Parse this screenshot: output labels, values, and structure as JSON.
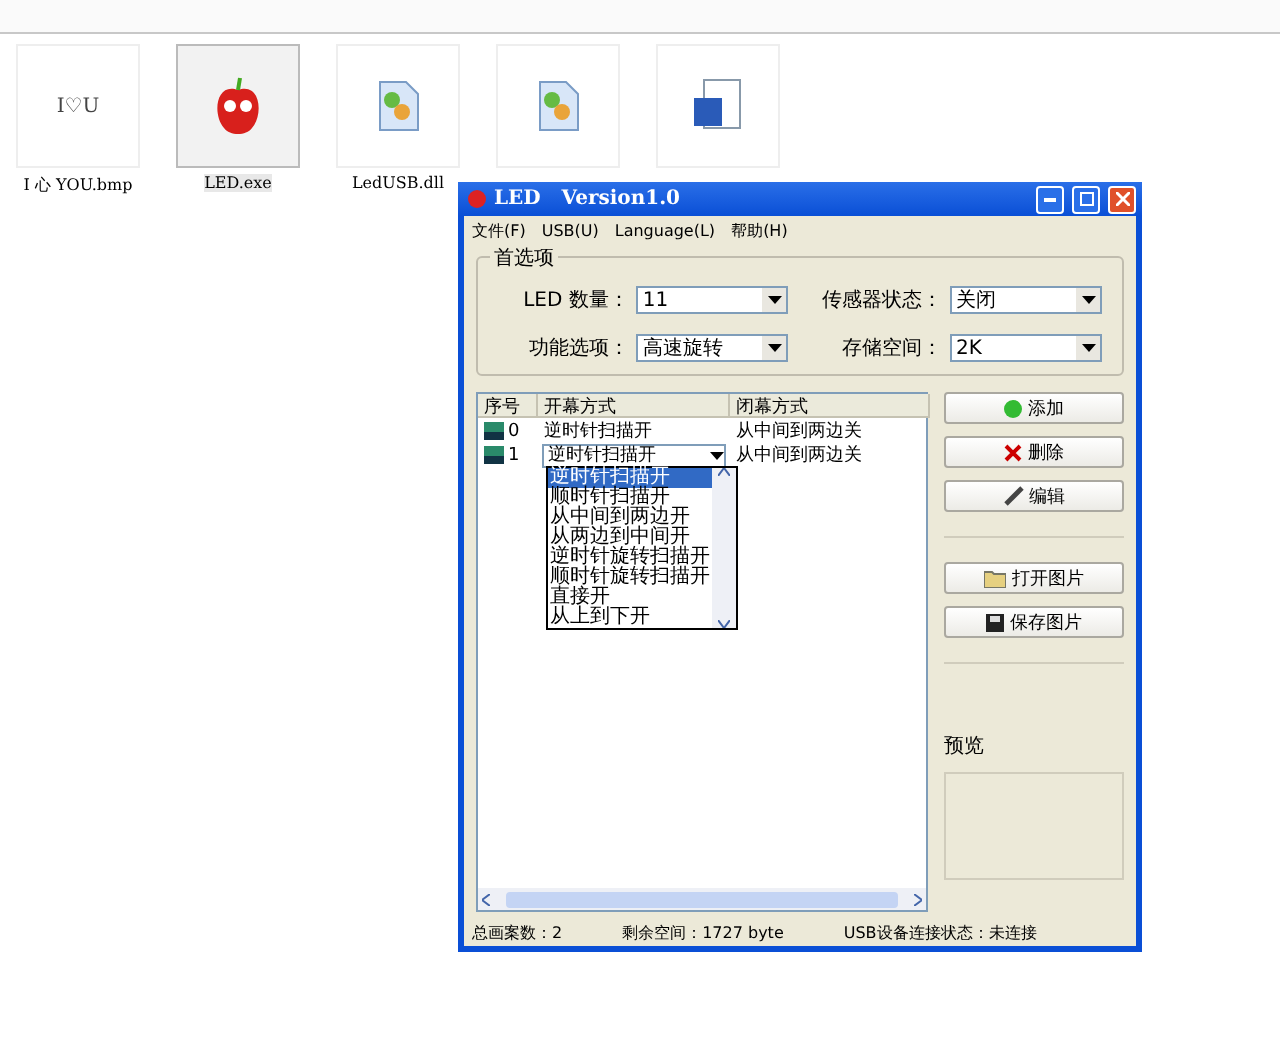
{
  "desktop_files": [
    {
      "name": "I 心 YOU.bmp",
      "kind": "bitmap",
      "thumb_text": "I♡U",
      "selected": false
    },
    {
      "name": "LED.exe",
      "kind": "app",
      "selected": true
    },
    {
      "name": "LedUSB.dll",
      "kind": "dll",
      "selected": false
    }
  ],
  "hidden_files": [
    {
      "kind": "dll"
    },
    {
      "kind": "doc"
    }
  ],
  "window": {
    "title": "LED   Version1.0",
    "menu": [
      "文件(F)",
      "USB(U)",
      "Language(L)",
      "帮助(H)"
    ],
    "preferences": {
      "title": "首选项",
      "fields": [
        {
          "label": "LED 数量：",
          "value": "11"
        },
        {
          "label": "传感器状态：",
          "value": "关闭"
        },
        {
          "label": "功能选项：",
          "value": "高速旋转"
        },
        {
          "label": "存储空间：",
          "value": "2K"
        }
      ]
    },
    "table": {
      "columns": [
        "序号",
        "开幕方式",
        "闭幕方式"
      ],
      "rows": [
        {
          "index": "0",
          "open": "逆时针扫描开",
          "close": "从中间到两边关",
          "editing": false
        },
        {
          "index": "1",
          "open": "逆时针扫描开",
          "close": "从中间到两边关",
          "editing": true
        }
      ],
      "dropdown_options": [
        {
          "label": "逆时针扫描开",
          "selected": true
        },
        {
          "label": "顺时针扫描开",
          "selected": false
        },
        {
          "label": "从中间到两边开",
          "selected": false
        },
        {
          "label": "从两边到中间开",
          "selected": false
        },
        {
          "label": "逆时针旋转扫描开",
          "selected": false
        },
        {
          "label": "顺时针旋转扫描开",
          "selected": false
        },
        {
          "label": "直接开",
          "selected": false
        },
        {
          "label": "从上到下开",
          "selected": false
        }
      ]
    },
    "buttons": [
      {
        "label": "添加",
        "kind": "add"
      },
      {
        "label": "删除",
        "kind": "delete"
      },
      {
        "label": "编辑",
        "kind": "edit"
      },
      {
        "label": "打开图片",
        "kind": "open"
      },
      {
        "label": "保存图片",
        "kind": "save"
      }
    ],
    "preview_title": "预览",
    "status_bar": [
      "总画案数：2",
      "剩余空间：1727 byte",
      "USB设备连接状态：未连接"
    ]
  }
}
